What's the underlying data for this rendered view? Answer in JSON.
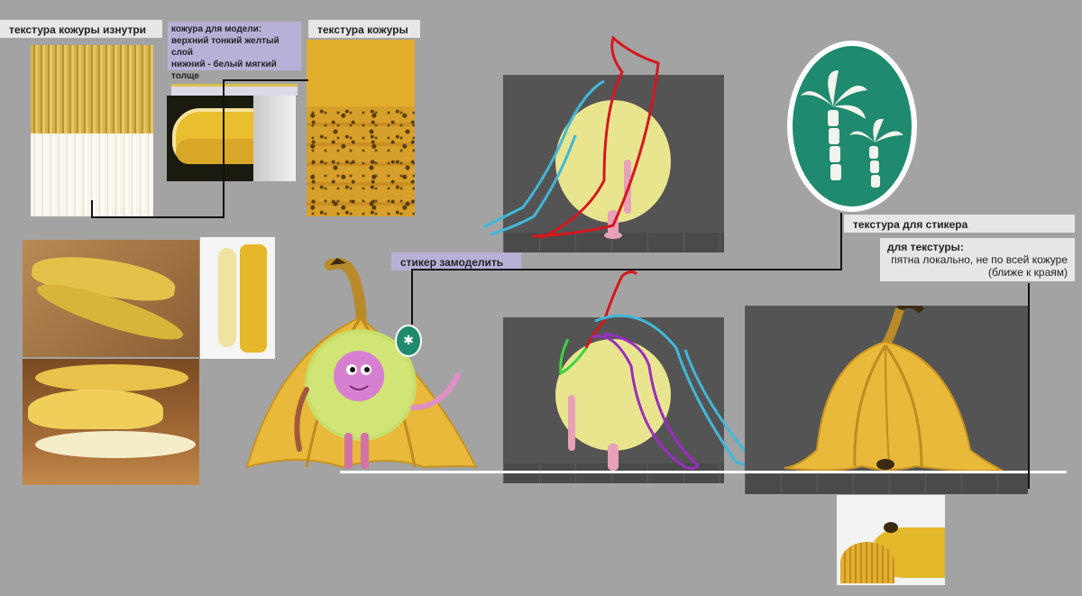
{
  "labels": {
    "inner_texture": "текстура кожуры изнутри",
    "peel_model_title": "кожура для модели:",
    "peel_model_line1": "верхний тонкий желтый слой",
    "peel_model_line2": "нижний - белый мягкий толще",
    "peel_texture": "текстура кожуры",
    "sticker_model": "стикер замоделить",
    "sticker_texture": "текстура для стикера",
    "texture_note_title": "для текстуры:",
    "texture_note_line1": "пятна локально, не по всей кожуре",
    "texture_note_line2": "(ближе к краям)"
  },
  "colors": {
    "background": "#a3a3a3",
    "label_bg": "#e6e6e6",
    "purple_label_bg": "#b9b0d8",
    "sticker_green": "#1f8a6d",
    "banana_yellow": "#e8b93a",
    "character_body": "#e9e58e",
    "fuzzy_green": "#c8de6a",
    "face_pink": "#d77fd0"
  },
  "icons": {
    "sticker": "palm-tree-icon"
  }
}
